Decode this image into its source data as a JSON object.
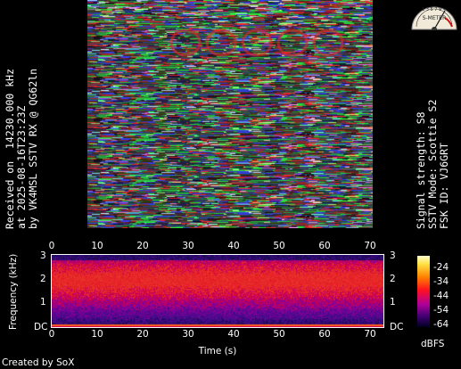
{
  "caption": {
    "left_line1": "Received on  14230.000 kHz",
    "left_line2": "at 2025-08-16T23:23Z",
    "left_line3": "by VK4MSL SSTV RX @ QG62ln",
    "right_line1": "Signal strength: S8",
    "right_line2": "SSTV Mode: Scottie S2",
    "right_line3": "FSK ID: VJ6GRT"
  },
  "meter": {
    "label": "S-METER",
    "scale": "1 3 5 7 9 +"
  },
  "spectrogram": {
    "y_label": "Frequency (kHz)",
    "x_label": "Time (s)",
    "x_ticks": [
      "0",
      "10",
      "20",
      "30",
      "40",
      "50",
      "60",
      "70"
    ],
    "y_ticks": [
      "3",
      "2",
      "1",
      "DC"
    ],
    "colorbar_ticks": [
      "-24",
      "-34",
      "-44",
      "-54",
      "-64"
    ],
    "colorbar_unit": "dBFS"
  },
  "credit": "Created by SoX",
  "colors": {
    "background": "#000000",
    "text": "#ffffff"
  }
}
